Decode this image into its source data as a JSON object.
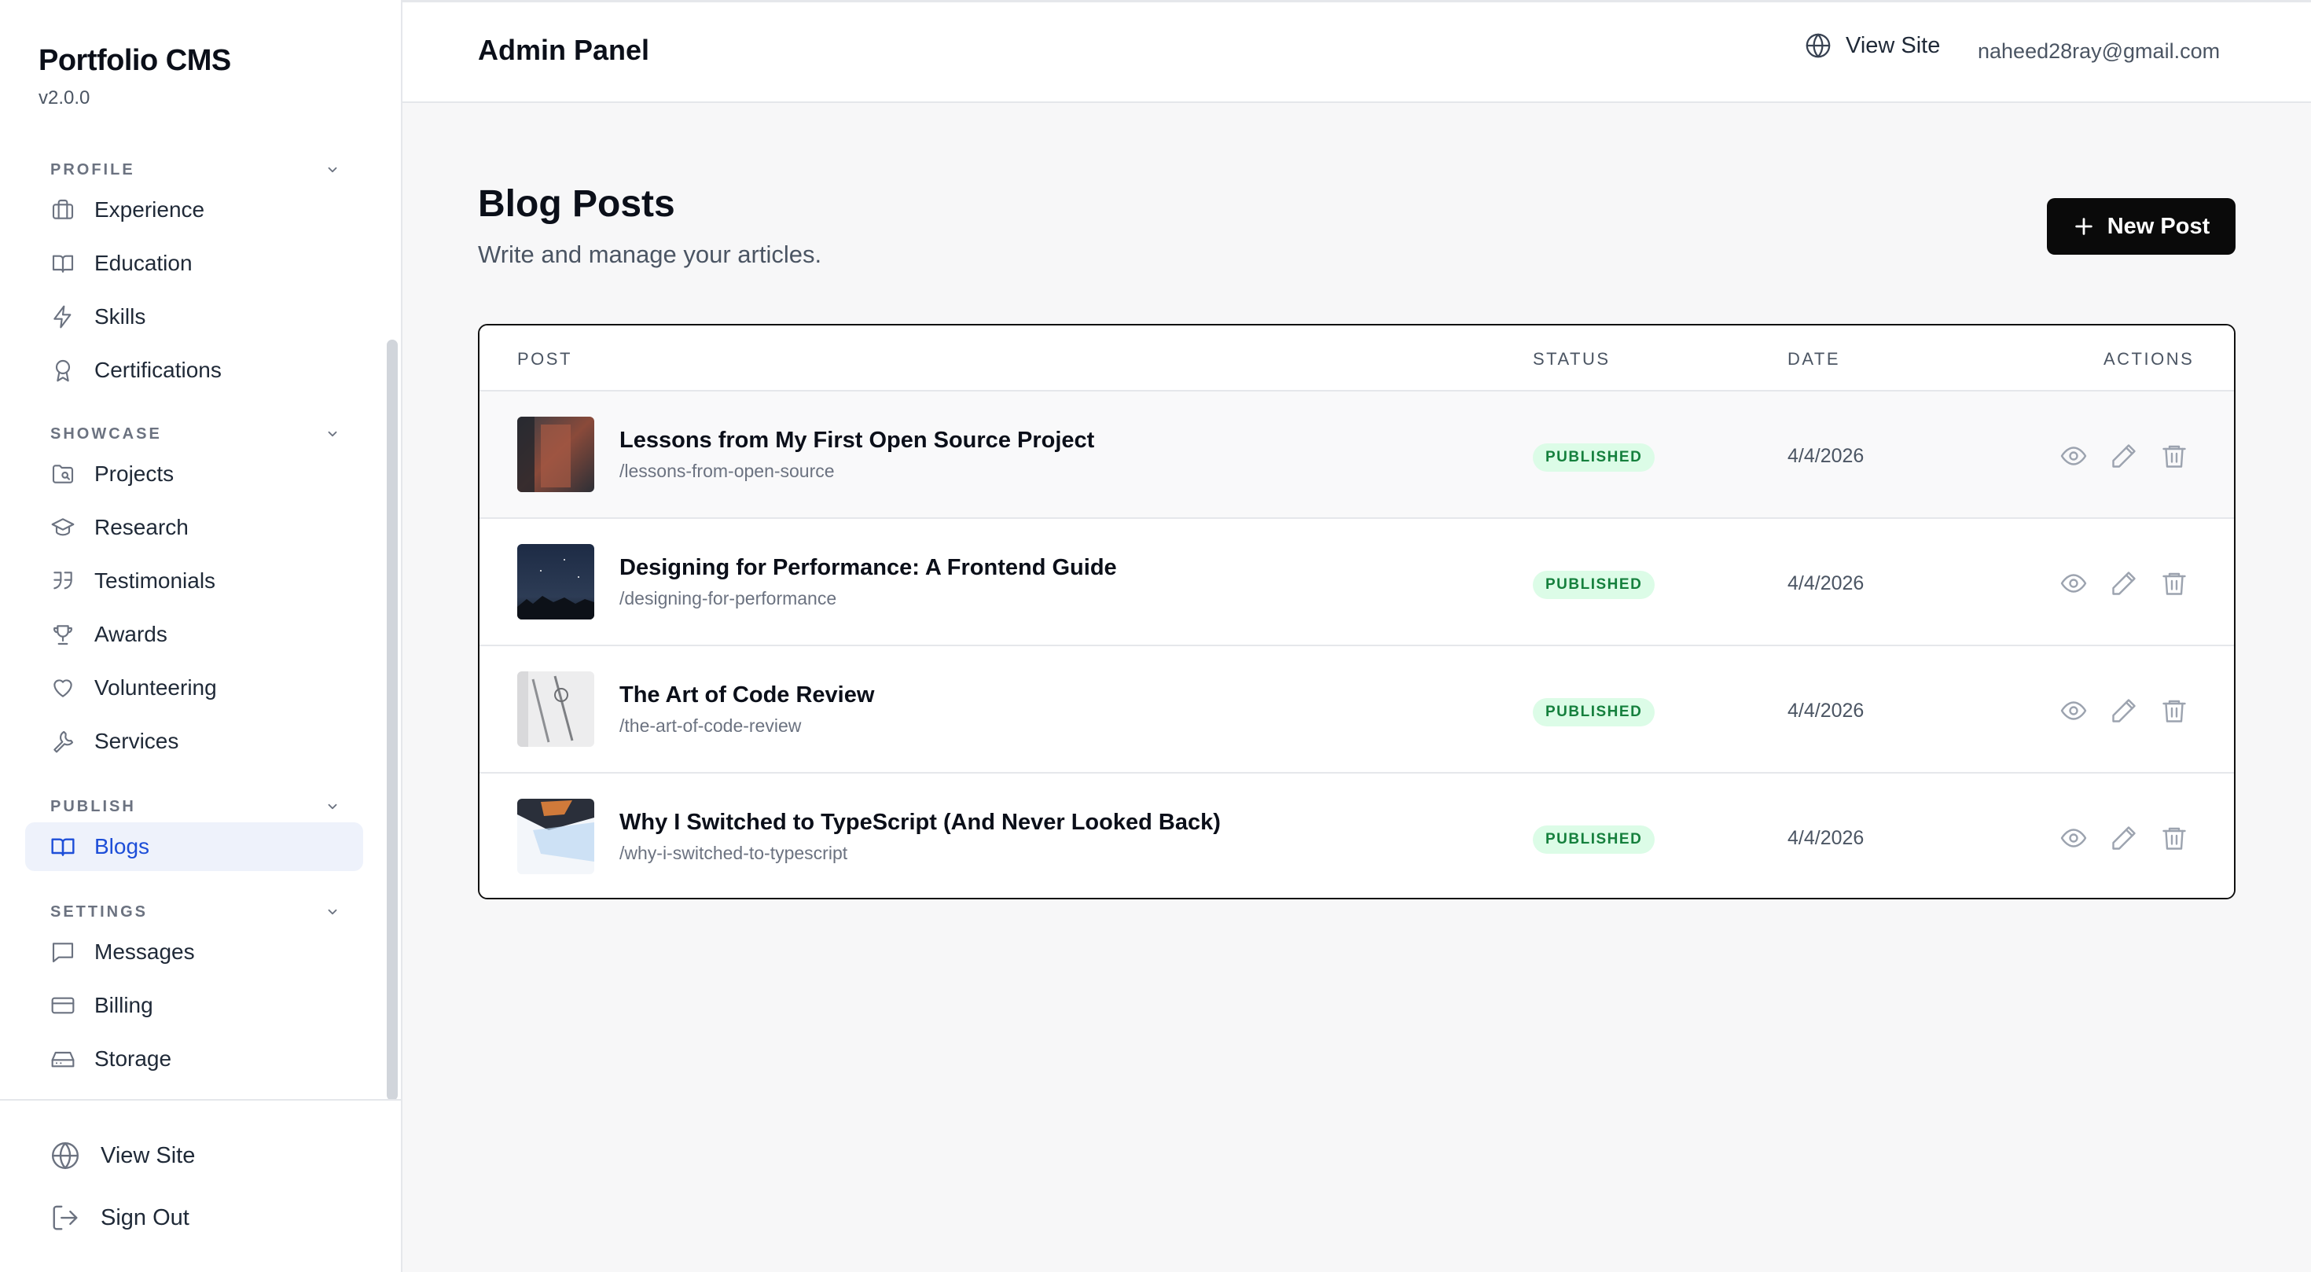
{
  "sidebar": {
    "brand_title": "Portfolio CMS",
    "brand_version": "v2.0.0",
    "sections": [
      {
        "label": "PROFILE",
        "items": [
          {
            "label": "Experience",
            "icon": "briefcase-icon"
          },
          {
            "label": "Education",
            "icon": "book-open-icon"
          },
          {
            "label": "Skills",
            "icon": "lightning-icon"
          },
          {
            "label": "Certifications",
            "icon": "award-icon"
          }
        ]
      },
      {
        "label": "SHOWCASE",
        "items": [
          {
            "label": "Projects",
            "icon": "folder-search-icon"
          },
          {
            "label": "Research",
            "icon": "graduation-cap-icon"
          },
          {
            "label": "Testimonials",
            "icon": "quote-icon"
          },
          {
            "label": "Awards",
            "icon": "trophy-icon"
          },
          {
            "label": "Volunteering",
            "icon": "heart-icon"
          },
          {
            "label": "Services",
            "icon": "wrench-icon"
          }
        ]
      },
      {
        "label": "PUBLISH",
        "items": [
          {
            "label": "Blogs",
            "icon": "book-icon",
            "active": true
          }
        ]
      },
      {
        "label": "SETTINGS",
        "items": [
          {
            "label": "Messages",
            "icon": "message-square-icon"
          },
          {
            "label": "Billing",
            "icon": "credit-card-icon"
          },
          {
            "label": "Storage",
            "icon": "hard-drive-icon"
          }
        ]
      }
    ],
    "footer": {
      "view_site": "View Site",
      "sign_out": "Sign Out"
    }
  },
  "header": {
    "title": "Admin Panel",
    "view_site": "View Site",
    "email": "naheed28ray@gmail.com"
  },
  "main": {
    "title": "Blog Posts",
    "subtitle": "Write and manage your articles.",
    "new_post_label": "New Post",
    "table": {
      "columns": [
        "POST",
        "STATUS",
        "DATE",
        "ACTIONS"
      ],
      "rows": [
        {
          "title": "Lessons from My First Open Source Project",
          "slug": "/lessons-from-open-source",
          "status": "PUBLISHED",
          "date": "4/4/2026"
        },
        {
          "title": "Designing for Performance: A Frontend Guide",
          "slug": "/designing-for-performance",
          "status": "PUBLISHED",
          "date": "4/4/2026"
        },
        {
          "title": "The Art of Code Review",
          "slug": "/the-art-of-code-review",
          "status": "PUBLISHED",
          "date": "4/4/2026"
        },
        {
          "title": "Why I Switched to TypeScript (And Never Looked Back)",
          "slug": "/why-i-switched-to-typescript",
          "status": "PUBLISHED",
          "date": "4/4/2026"
        }
      ]
    }
  },
  "colors": {
    "accent": "#1d4ed8",
    "active_bg": "#eef2fb",
    "badge_bg": "#dcfce7",
    "badge_text": "#15803d",
    "button_bg": "#0a0a0a"
  }
}
